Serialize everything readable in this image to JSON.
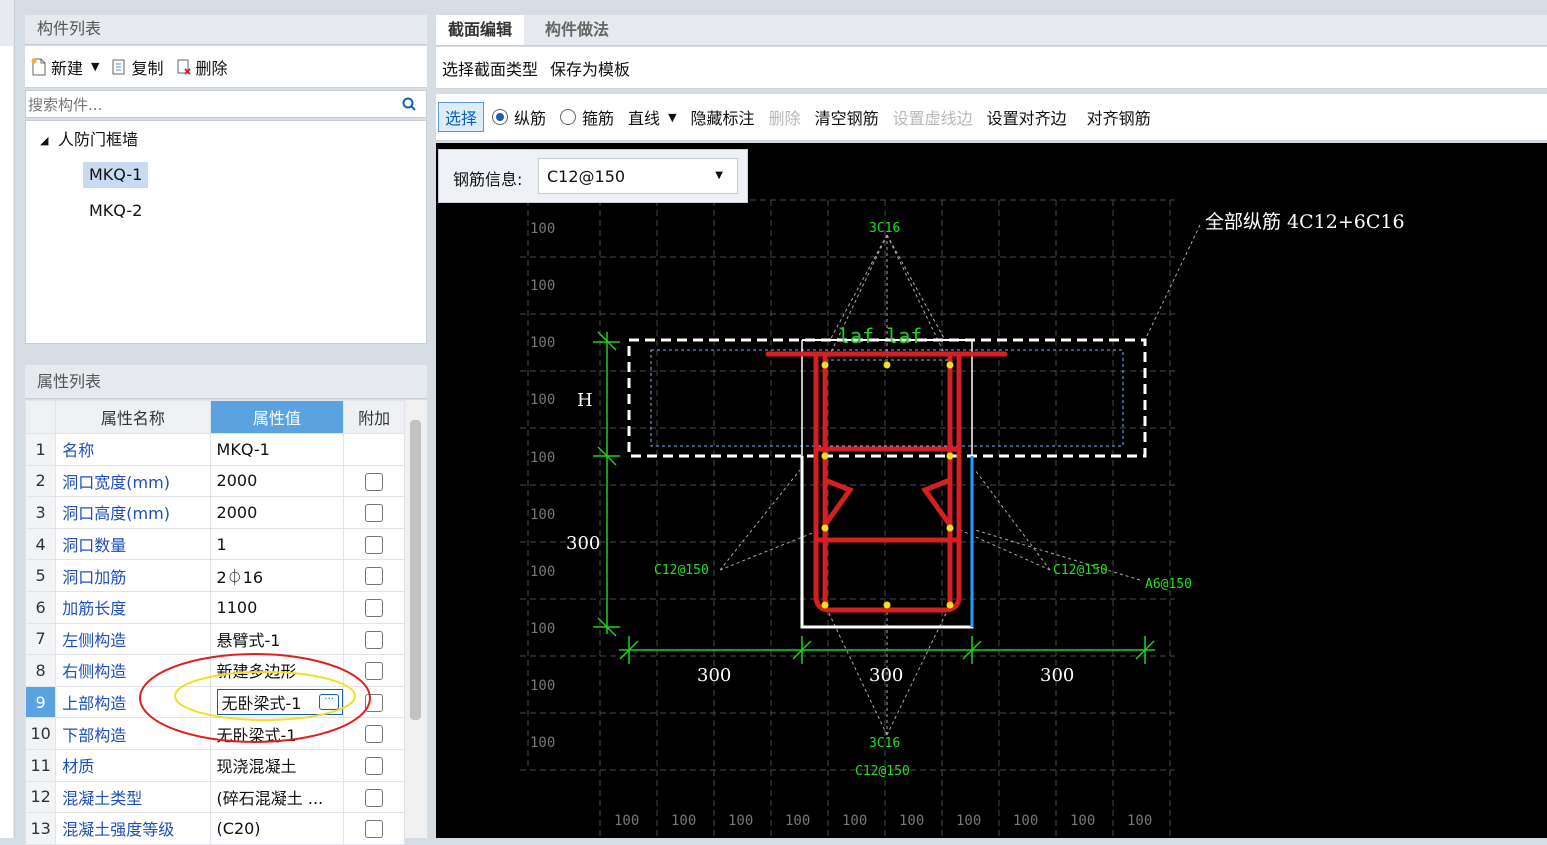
{
  "left_panel": {
    "title": "构件列表",
    "toolbar": {
      "new_label": "新建",
      "copy_label": "复制",
      "delete_label": "删除"
    },
    "search": {
      "placeholder": "搜索构件..."
    },
    "tree": {
      "group": "人防门框墙",
      "items": [
        "MKQ-1",
        "MKQ-2"
      ]
    }
  },
  "props_panel": {
    "title": "属性列表",
    "headers": [
      "属性名称",
      "属性值",
      "附加"
    ],
    "rows": [
      {
        "num": "1",
        "name": "名称",
        "value": "MKQ-1"
      },
      {
        "num": "2",
        "name": "洞口宽度(mm)",
        "value": "2000"
      },
      {
        "num": "3",
        "name": "洞口高度(mm)",
        "value": "2000"
      },
      {
        "num": "4",
        "name": "洞口数量",
        "value": "1"
      },
      {
        "num": "5",
        "name": "洞口加筋",
        "value": "2⏀16"
      },
      {
        "num": "6",
        "name": "加筋长度",
        "value": "1100"
      },
      {
        "num": "7",
        "name": "左侧构造",
        "value": "悬臂式-1"
      },
      {
        "num": "8",
        "name": "右侧构造",
        "value": "新建多边形"
      },
      {
        "num": "9",
        "name": "上部构造",
        "value": "无卧梁式-1"
      },
      {
        "num": "10",
        "name": "下部构造",
        "value": "无卧梁式-1"
      },
      {
        "num": "11",
        "name": "材质",
        "value": "现浇混凝土"
      },
      {
        "num": "12",
        "name": "混凝土类型",
        "value": "(碎石混凝土 ..."
      },
      {
        "num": "13",
        "name": "混凝土强度等级",
        "value": "(C20)"
      }
    ]
  },
  "editor": {
    "tabs": [
      "截面编辑",
      "构件做法"
    ],
    "toolbar1": [
      "选择截面类型",
      "保存为模板"
    ],
    "toolbar2": {
      "select": "选择",
      "radio_long": "纵筋",
      "radio_stirrup": "箍筋",
      "line": "直线",
      "hide_marks": "隐藏标注",
      "delete": "删除",
      "clear_rebar": "清空钢筋",
      "set_dashed": "设置虚线边",
      "set_align_edge": "设置对齐边",
      "align_rebar": "对齐钢筋"
    },
    "rebar_info_label": "钢筋信息:",
    "rebar_info_value": "C12@150",
    "canvas": {
      "all_long_bars": "全部纵筋 4C12+6C16",
      "top_bars": "3C16",
      "bottom_bars": "3C16",
      "bottom_stirrup": "C12@150",
      "left_stirrup": "C12@150",
      "right_stirrup": "C12@150",
      "right_extra": "A6@150",
      "laf_label": "laf laf",
      "h_label": "H",
      "dim_300_v": "300",
      "dim_300_1": "300",
      "dim_300_2": "300",
      "dim_300_3": "300",
      "grid_label": "100"
    }
  }
}
